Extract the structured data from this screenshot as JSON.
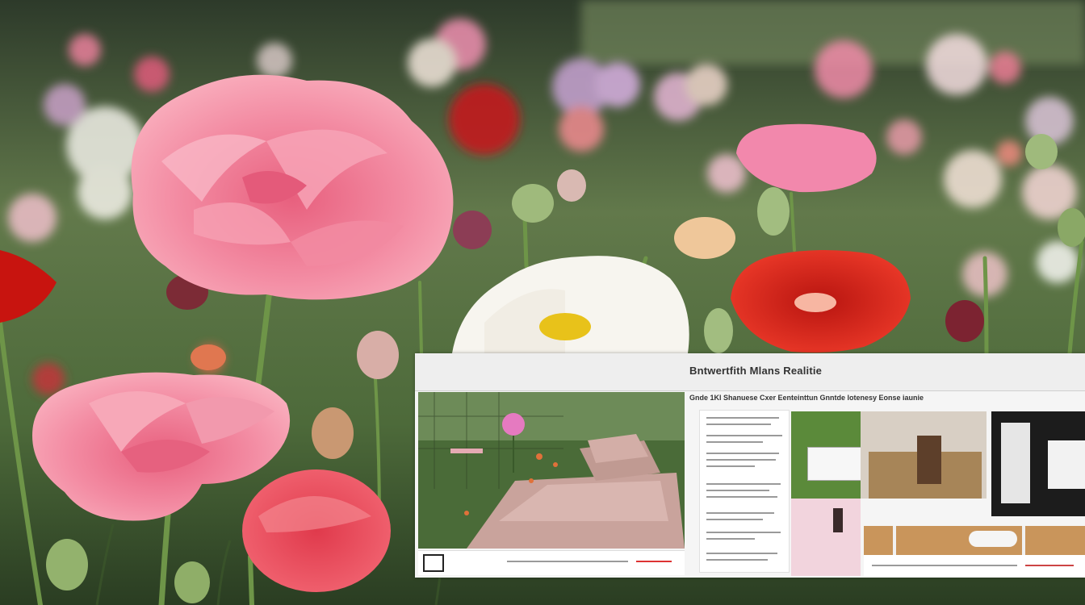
{
  "scene": {
    "description_free": true,
    "colors": {
      "foliage_dark": "#2f4526",
      "foliage_mid": "#5f7f45",
      "pink_petal": "#f07a96",
      "coral_petal": "#e94d5a",
      "red_petal": "#d9261c",
      "white_petal": "#f7f5ef",
      "yellow_center": "#e8c21a"
    }
  },
  "panel": {
    "title": "Bntwertfith Mlans Realitie",
    "subtitle": "Gnde 1Kl Shanuese  Cxer Eenteinttun  Gnntde lotenesy Eonse iaunie"
  }
}
